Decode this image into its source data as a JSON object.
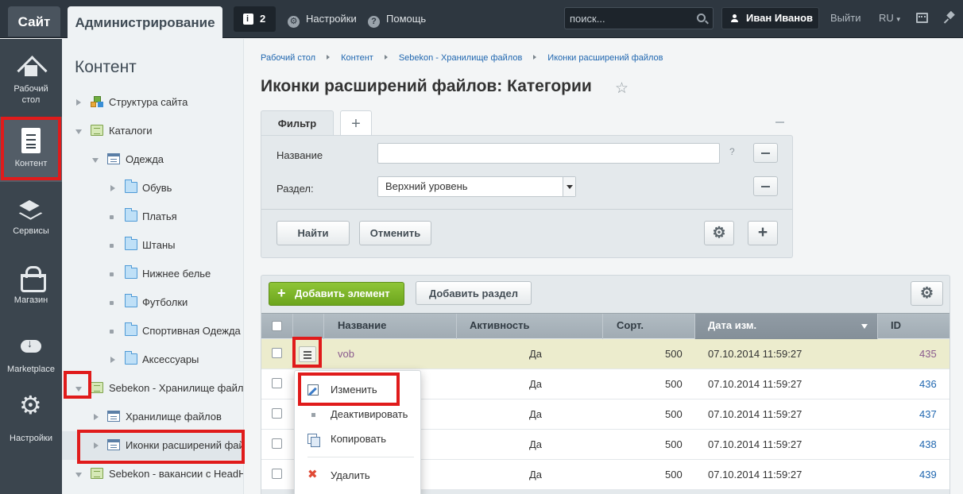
{
  "topbar": {
    "site_tab": "Сайт",
    "admin_tab": "Администрирование",
    "notifications_count": "2",
    "settings_label": "Настройки",
    "help_label": "Помощь",
    "search_placeholder": "поиск...",
    "user_name": "Иван Иванов",
    "logout_label": "Выйти",
    "lang_label": "RU"
  },
  "leftnav": {
    "items": [
      {
        "label": "Рабочий стол",
        "icon": "home-icon"
      },
      {
        "label": "Контент",
        "icon": "document-icon",
        "active": true
      },
      {
        "label": "Сервисы",
        "icon": "layers-icon"
      },
      {
        "label": "Магазин",
        "icon": "basket-icon"
      },
      {
        "label": "Marketplace",
        "icon": "cloud-icon"
      },
      {
        "label": "Настройки",
        "icon": "gear-icon"
      }
    ]
  },
  "tree": {
    "title": "Контент",
    "items": [
      {
        "label": "Структура сайта",
        "icon": "structure-icon",
        "state": "collapsed"
      },
      {
        "label": "Каталоги",
        "icon": "catalog-icon",
        "state": "expanded"
      },
      {
        "label": "Одежда",
        "icon": "list-icon",
        "state": "expanded"
      },
      {
        "label": "Обувь",
        "icon": "folder-icon",
        "state": "collapsed"
      },
      {
        "label": "Платья",
        "icon": "folder-icon",
        "state": "leaf"
      },
      {
        "label": "Штаны",
        "icon": "folder-icon",
        "state": "leaf"
      },
      {
        "label": "Нижнее белье",
        "icon": "folder-icon",
        "state": "leaf"
      },
      {
        "label": "Футболки",
        "icon": "folder-icon",
        "state": "leaf"
      },
      {
        "label": "Спортивная Одежда",
        "icon": "folder-icon",
        "state": "leaf"
      },
      {
        "label": "Аксессуары",
        "icon": "folder-icon",
        "state": "collapsed"
      },
      {
        "label": "Sebekon - Хранилище файлов",
        "icon": "catalog-icon",
        "state": "expanded"
      },
      {
        "label": "Хранилище файлов",
        "icon": "list-icon",
        "state": "collapsed"
      },
      {
        "label": "Иконки расширений файлов",
        "icon": "list-icon",
        "state": "collapsed",
        "selected": true
      },
      {
        "label": "Sebekon - вакансии с HeadHunter",
        "icon": "catalog-icon",
        "state": "expanded"
      }
    ]
  },
  "breadcrumbs": [
    "Рабочий стол",
    "Контент",
    "Sebekon - Хранилище файлов",
    "Иконки расширений файлов"
  ],
  "page_title": "Иконки расширений файлов: Категории",
  "filter": {
    "tab_label": "Фильтр",
    "add_tab_label": "+",
    "name_label": "Название",
    "name_value": "",
    "help_mark": "?",
    "section_label": "Раздел:",
    "section_value": "Верхний уровень",
    "find_button": "Найти",
    "cancel_button": "Отменить"
  },
  "toolbar": {
    "add_element": "Добавить элемент",
    "add_section": "Добавить раздел"
  },
  "grid": {
    "columns": [
      "Название",
      "Активность",
      "Сорт.",
      "Дата изм.",
      "ID"
    ],
    "sorted_column": "Дата изм.",
    "rows": [
      {
        "name": "vob",
        "active": "Да",
        "sort": "500",
        "date": "07.10.2014 11:59:27",
        "id": "435",
        "highlight": true
      },
      {
        "name": "",
        "active": "Да",
        "sort": "500",
        "date": "07.10.2014 11:59:27",
        "id": "436"
      },
      {
        "name": "",
        "active": "Да",
        "sort": "500",
        "date": "07.10.2014 11:59:27",
        "id": "437"
      },
      {
        "name": "",
        "active": "Да",
        "sort": "500",
        "date": "07.10.2014 11:59:27",
        "id": "438"
      },
      {
        "name": "",
        "active": "Да",
        "sort": "500",
        "date": "07.10.2014 11:59:27",
        "id": "439"
      }
    ]
  },
  "context_menu": {
    "edit": "Изменить",
    "deactivate": "Деактивировать",
    "copy": "Копировать",
    "delete": "Удалить"
  },
  "colors": {
    "highlight_red": "#e01b1b",
    "add_button_green": "#7ab52a",
    "highlight_row": "#ececcd",
    "link_blue": "#2067b0"
  }
}
